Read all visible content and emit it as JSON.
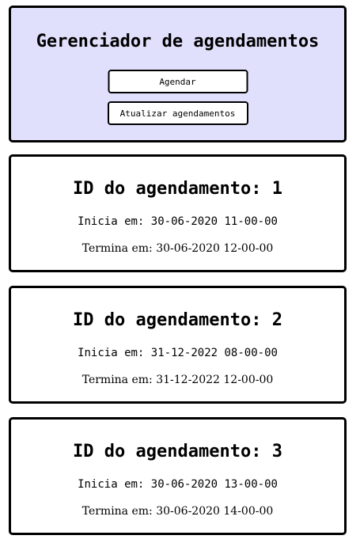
{
  "header": {
    "title": "Gerenciador de agendamentos",
    "schedule_button": "Agendar",
    "refresh_button": "Atualizar agendamentos",
    "background_color": "#e0e0fc"
  },
  "appointments": [
    {
      "title": "ID do agendamento: 1",
      "start": "Inicia em: 30-06-2020 11-00-00",
      "end": "Termina em: 30-06-2020 12-00-00"
    },
    {
      "title": "ID do agendamento: 2",
      "start": "Inicia em: 31-12-2022 08-00-00",
      "end": "Termina em: 31-12-2022 12-00-00"
    },
    {
      "title": "ID do agendamento: 3",
      "start": "Inicia em: 30-06-2020 13-00-00",
      "end": "Termina em: 30-06-2020 14-00-00"
    }
  ]
}
